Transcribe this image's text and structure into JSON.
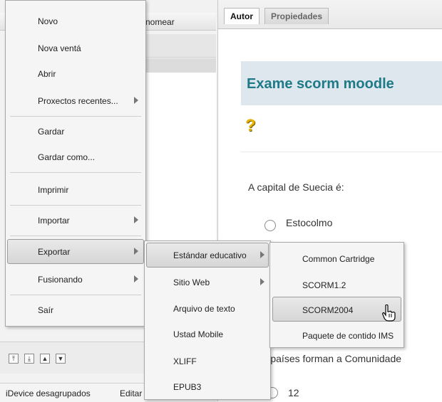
{
  "outline": {
    "header_rename_label": "nomear",
    "toolbar_icons": [
      "promote-icon",
      "demote-icon",
      "move-up-icon",
      "move-down-icon"
    ]
  },
  "bottom_bar": {
    "idevices_label": "iDevice desagrupados",
    "edit_label": "Editar"
  },
  "tabs": [
    {
      "label": "Autor",
      "active": true
    },
    {
      "label": "Propiedades",
      "active": false
    }
  ],
  "content": {
    "title": "Exame scorm moodle",
    "question_icon": "?",
    "question": "A capital de Suecia é:",
    "option1": "Estocolmo",
    "question2": "ntos países forman a Comunidade",
    "option_12": "12"
  },
  "file_menu": {
    "items": [
      "Novo",
      "Nova ventá",
      "Abrir",
      "Proxectos recentes...",
      "Gardar",
      "Gardar como...",
      "Imprimir",
      "Importar",
      "Exportar",
      "Fusionando",
      "Saír"
    ]
  },
  "export_menu": {
    "items": [
      "Estándar educativo",
      "Sitio Web",
      "Arquivo de texto",
      "Ustad Mobile",
      "XLIFF",
      "EPUB3"
    ]
  },
  "standard_menu": {
    "items": [
      "Common Cartridge",
      "SCORM1.2",
      "SCORM2004",
      "Paquete de contido IMS"
    ]
  },
  "colors": {
    "title_text": "#1f7a87",
    "title_band": "#dfe7ee",
    "question_icon": "#e3b400"
  }
}
